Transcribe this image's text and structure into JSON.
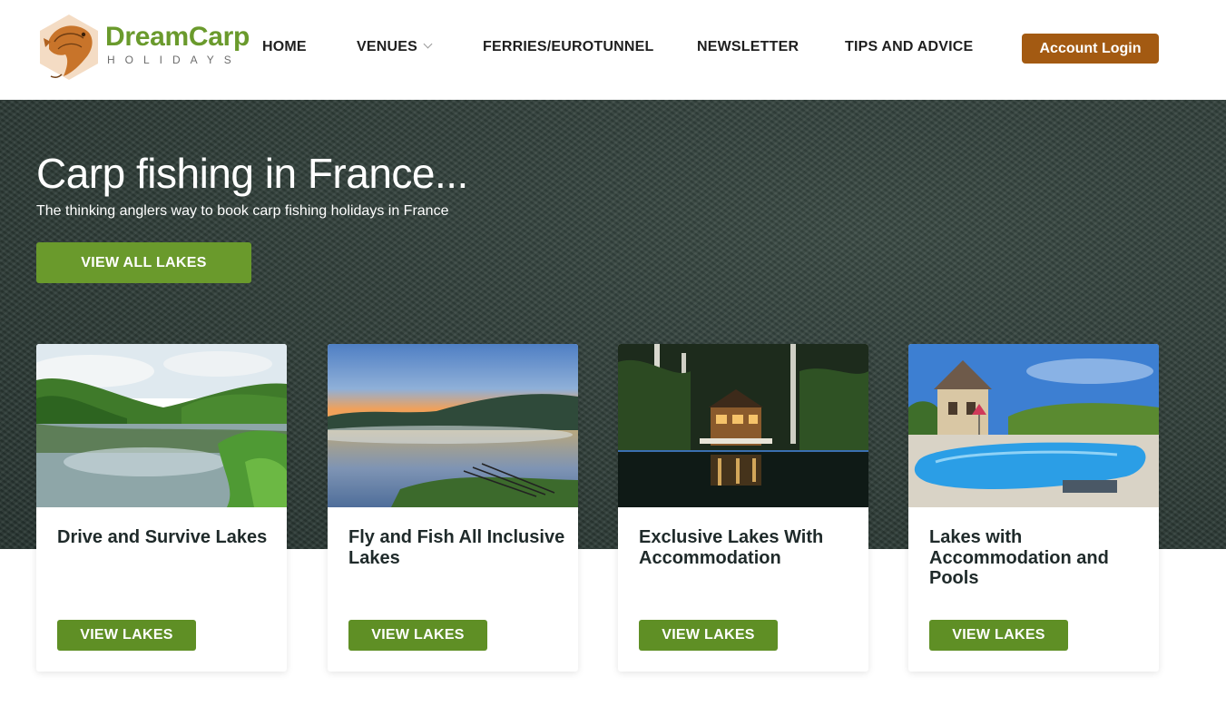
{
  "brand": {
    "name": "DreamCarp",
    "tagline": "HOLIDAYS",
    "primary_color": "#6a9a2c",
    "accent_color": "#a35a12"
  },
  "nav": {
    "items": [
      {
        "label": "HOME"
      },
      {
        "label": "VENUES",
        "has_dropdown": true
      },
      {
        "label": "FERRIES/EUROTUNNEL"
      },
      {
        "label": "NEWSLETTER"
      },
      {
        "label": "TIPS AND ADVICE"
      }
    ],
    "login_label": "Account Login"
  },
  "hero": {
    "title": "Carp fishing in France...",
    "subtitle": "The thinking anglers way to book carp fishing holidays in France",
    "button_label": "VIEW ALL LAKES"
  },
  "cards": [
    {
      "title": "Drive and Survive Lakes",
      "button_label": "VIEW LAKES",
      "image": "green-forest-lake"
    },
    {
      "title": "Fly and Fish All Inclusive Lakes",
      "button_label": "VIEW LAKES",
      "image": "misty-sunrise-lake-with-rods"
    },
    {
      "title": "Exclusive Lakes With Accommodation",
      "button_label": "VIEW LAKES",
      "image": "lit-lakeside-lodge-at-night"
    },
    {
      "title": "Lakes with Accommodation and Pools",
      "button_label": "VIEW LAKES",
      "image": "stone-cottage-with-swimming-pool"
    }
  ]
}
